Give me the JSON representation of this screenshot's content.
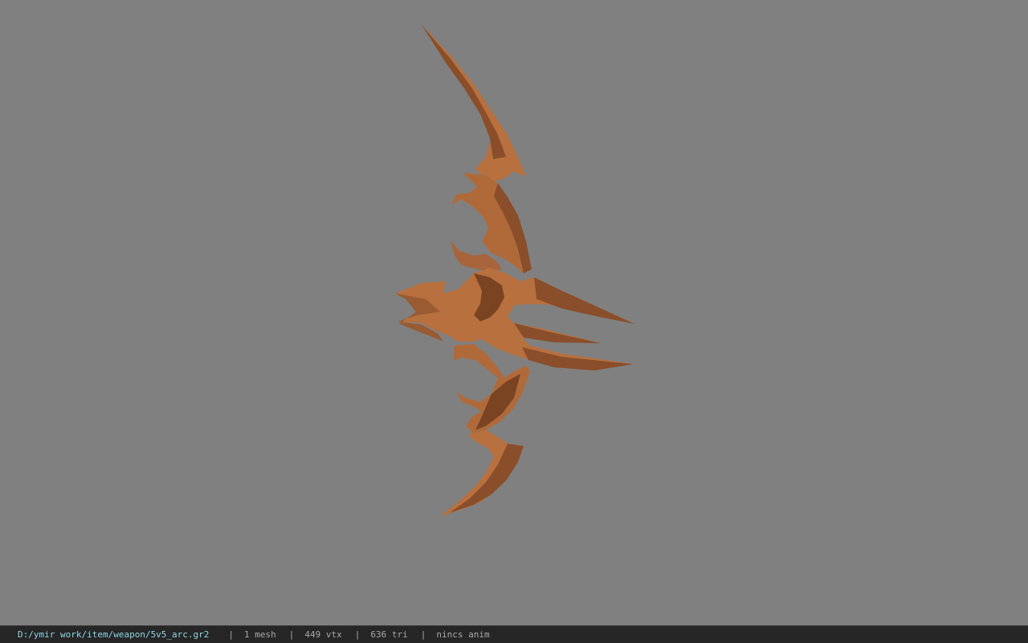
{
  "viewer": {
    "background_color": "#808080",
    "model_color": "#b8703e",
    "model_shadow_color": "#7a4422",
    "model_highlight_color": "#c98650"
  },
  "status": {
    "file_path": "D:/ymir work/item/weapon/5v5_arc.gr2",
    "separator": "|",
    "mesh_count": "1 mesh",
    "vertex_count": "449 vtx",
    "triangle_count": "636 tri",
    "animation": "nincs anim"
  }
}
